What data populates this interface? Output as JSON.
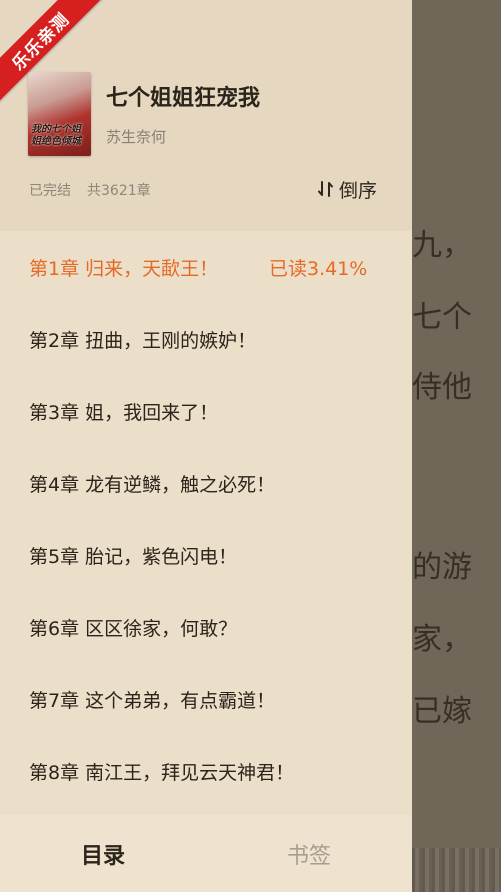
{
  "reader": {
    "lines": [
      "九，",
      "七个",
      "侍他",
      "",
      "的游",
      "家，",
      "已嫁"
    ]
  },
  "book": {
    "title": "七个姐姐狂宠我",
    "author": "苏生奈何",
    "cover_text": "我的七个姐姐绝色倾城",
    "status": "已完结",
    "chapter_count": "共3621章",
    "sort_label": "倒序",
    "sort_icon": "sort-arrows-icon"
  },
  "chapters": [
    {
      "title": "第1章  归来，天歃王！",
      "progress": "已读3.41%"
    },
    {
      "title": "第2章 扭曲，王刚的嫉妒！"
    },
    {
      "title": "第3章 姐，我回来了！"
    },
    {
      "title": "第4章 龙有逆鳞，触之必死！"
    },
    {
      "title": "第5章 胎记，紫色闪电！"
    },
    {
      "title": "第6章 区区徐家，何敢？"
    },
    {
      "title": "第7章 这个弟弟，有点霸道！"
    },
    {
      "title": "第8章 南江王，拜见云天神君！"
    }
  ],
  "tabs": {
    "catalog": "目录",
    "bookmarks": "书签"
  },
  "ribbon": "乐乐亲测",
  "colors": {
    "accent": "#e66a24",
    "drawer_bg": "#ebdfca",
    "ribbon": "#d62020"
  }
}
